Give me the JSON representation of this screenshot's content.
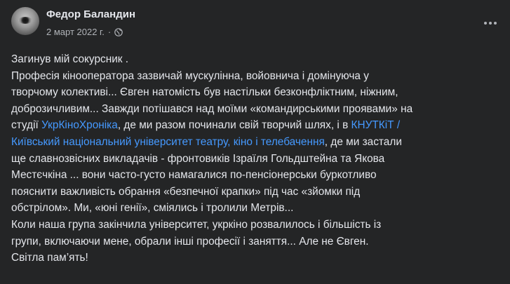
{
  "post": {
    "author": "Федор Баландин",
    "timestamp": "2 март 2022 г.",
    "separator": "·",
    "privacy_icon": "globe-icon",
    "more_icon": "more-options-icon",
    "lines": {
      "l1": "Загинув мій сокурсник .",
      "l2": "Професія кінооператора зазвичай мускулінна, войовнича і домінуюча у",
      "l3": "творчому колективі... Євген натомість був настільки безконфліктним, ніжним,",
      "l4": "доброзичливим... Завжди потішався над моїми «командирськими проявами» на",
      "l5a": "студії ",
      "l5_link1": "УкрКіноХроніка",
      "l5b": ", де ми разом  починали свій творчий шлях, і в ",
      "l5_link2": "КНУТКіТ /",
      "l6_link": "Київський національний університет театру, кіно і телебачення",
      "l6b": ", де ми застали",
      "l7": "ще славнозвісних викладачів - фронтовиків Ізраїля Гольдштейна та Якова",
      "l8": "Местєчкіна ... вони часто-густо намагалися по-пенсіонерськи буркотливо",
      "l9": "пояснити важливість обрання «безпечної крапки» під час «зйомки під",
      "l10": "обстрілом». Ми, «юні генії», сміялись і тролили Метрів...",
      "l11": "Коли наша група закінчила університет, укркіно розвалилось і більшість із",
      "l12": "групи, включаючи мене, обрали інші професії і заняття... Але не Євген.",
      "l13": "Світла пам’ять!"
    }
  },
  "colors": {
    "background": "#242526",
    "primary_text": "#e4e6eb",
    "secondary_text": "#b0b3b8",
    "link": "#4599ff"
  }
}
